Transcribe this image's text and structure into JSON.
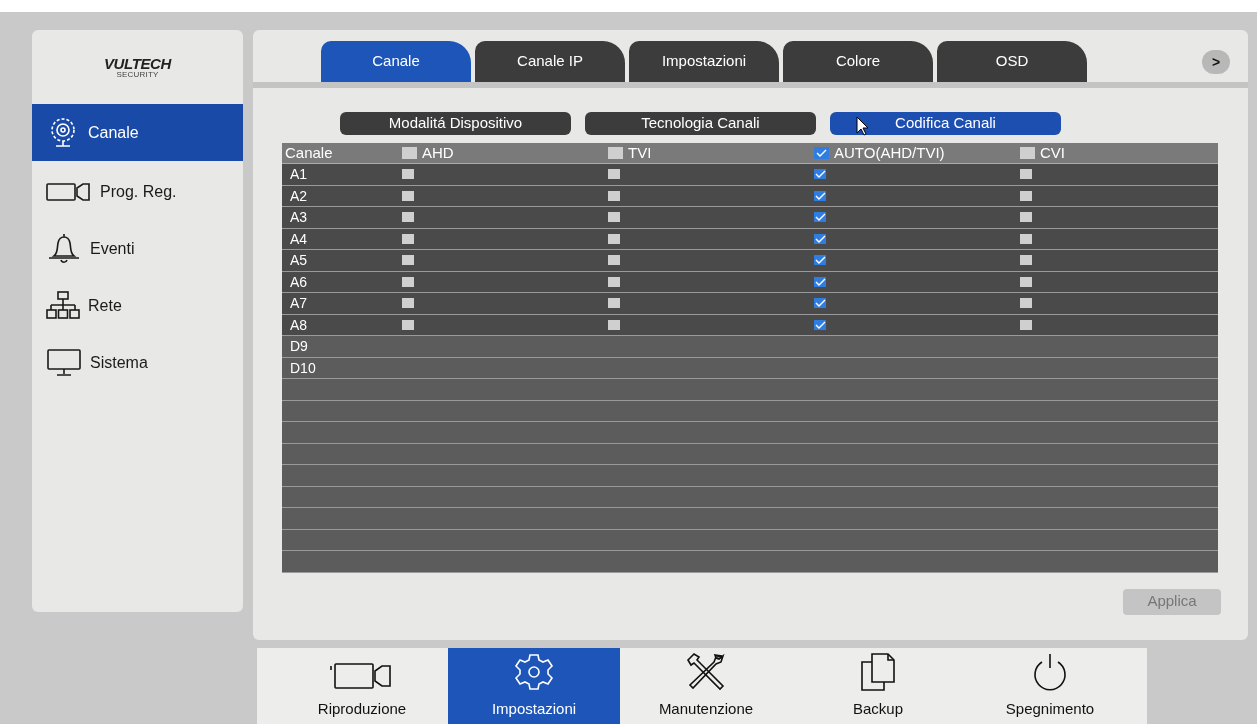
{
  "logo": {
    "text": "VULTECH",
    "subtext": "SECURITY"
  },
  "sidebar": {
    "items": [
      {
        "kind": "camera",
        "label": "Canale",
        "selected": true
      },
      {
        "kind": "record",
        "label": "Prog. Reg.",
        "selected": false
      },
      {
        "kind": "bell",
        "label": "Eventi",
        "selected": false
      },
      {
        "kind": "network",
        "label": "Rete",
        "selected": false
      },
      {
        "kind": "monitor",
        "label": "Sistema",
        "selected": false
      }
    ]
  },
  "tabs": [
    {
      "label": "Canale",
      "selected": true
    },
    {
      "label": "Canale IP",
      "selected": false
    },
    {
      "label": "Impostazioni",
      "selected": false
    },
    {
      "label": "Colore",
      "selected": false
    },
    {
      "label": "OSD",
      "selected": false
    }
  ],
  "next_button": ">",
  "subtabs": [
    {
      "label": "Modalitá Dispositivo",
      "selected": false
    },
    {
      "label": "Tecnologia Canali",
      "selected": false
    },
    {
      "label": "Codifica Canali",
      "selected": true
    }
  ],
  "table": {
    "first_column": "Canale",
    "columns": [
      {
        "label": "AHD",
        "checked": false
      },
      {
        "label": "TVI",
        "checked": false
      },
      {
        "label": "AUTO(AHD/TVI)",
        "checked": true
      },
      {
        "label": "CVI",
        "checked": false
      }
    ],
    "rows": [
      {
        "channel": "A1",
        "cells": [
          {
            "checked": false
          },
          {
            "checked": false
          },
          {
            "checked": true
          },
          {
            "checked": false
          }
        ]
      },
      {
        "channel": "A2",
        "cells": [
          {
            "checked": false
          },
          {
            "checked": false
          },
          {
            "checked": true
          },
          {
            "checked": false
          }
        ]
      },
      {
        "channel": "A3",
        "cells": [
          {
            "checked": false
          },
          {
            "checked": false
          },
          {
            "checked": true
          },
          {
            "checked": false
          }
        ]
      },
      {
        "channel": "A4",
        "cells": [
          {
            "checked": false
          },
          {
            "checked": false
          },
          {
            "checked": true
          },
          {
            "checked": false
          }
        ]
      },
      {
        "channel": "A5",
        "cells": [
          {
            "checked": false
          },
          {
            "checked": false
          },
          {
            "checked": true
          },
          {
            "checked": false
          }
        ]
      },
      {
        "channel": "A6",
        "cells": [
          {
            "checked": false
          },
          {
            "checked": false
          },
          {
            "checked": true
          },
          {
            "checked": false
          }
        ]
      },
      {
        "channel": "A7",
        "cells": [
          {
            "checked": false
          },
          {
            "checked": false
          },
          {
            "checked": true
          },
          {
            "checked": false
          }
        ]
      },
      {
        "channel": "A8",
        "cells": [
          {
            "checked": false
          },
          {
            "checked": false
          },
          {
            "checked": true
          },
          {
            "checked": false
          }
        ]
      },
      {
        "channel": "D9"
      },
      {
        "channel": "D10"
      }
    ]
  },
  "apply_button": {
    "label": "Applica",
    "disabled": true
  },
  "bottom_nav": [
    {
      "kind": "playback",
      "label": "Riproduzione",
      "selected": false
    },
    {
      "kind": "settings",
      "label": "Impostazioni",
      "selected": true
    },
    {
      "kind": "tools",
      "label": "Manutenzione",
      "selected": false
    },
    {
      "kind": "backup",
      "label": "Backup",
      "selected": false
    },
    {
      "kind": "power",
      "label": "Spegnimento",
      "selected": false
    }
  ]
}
